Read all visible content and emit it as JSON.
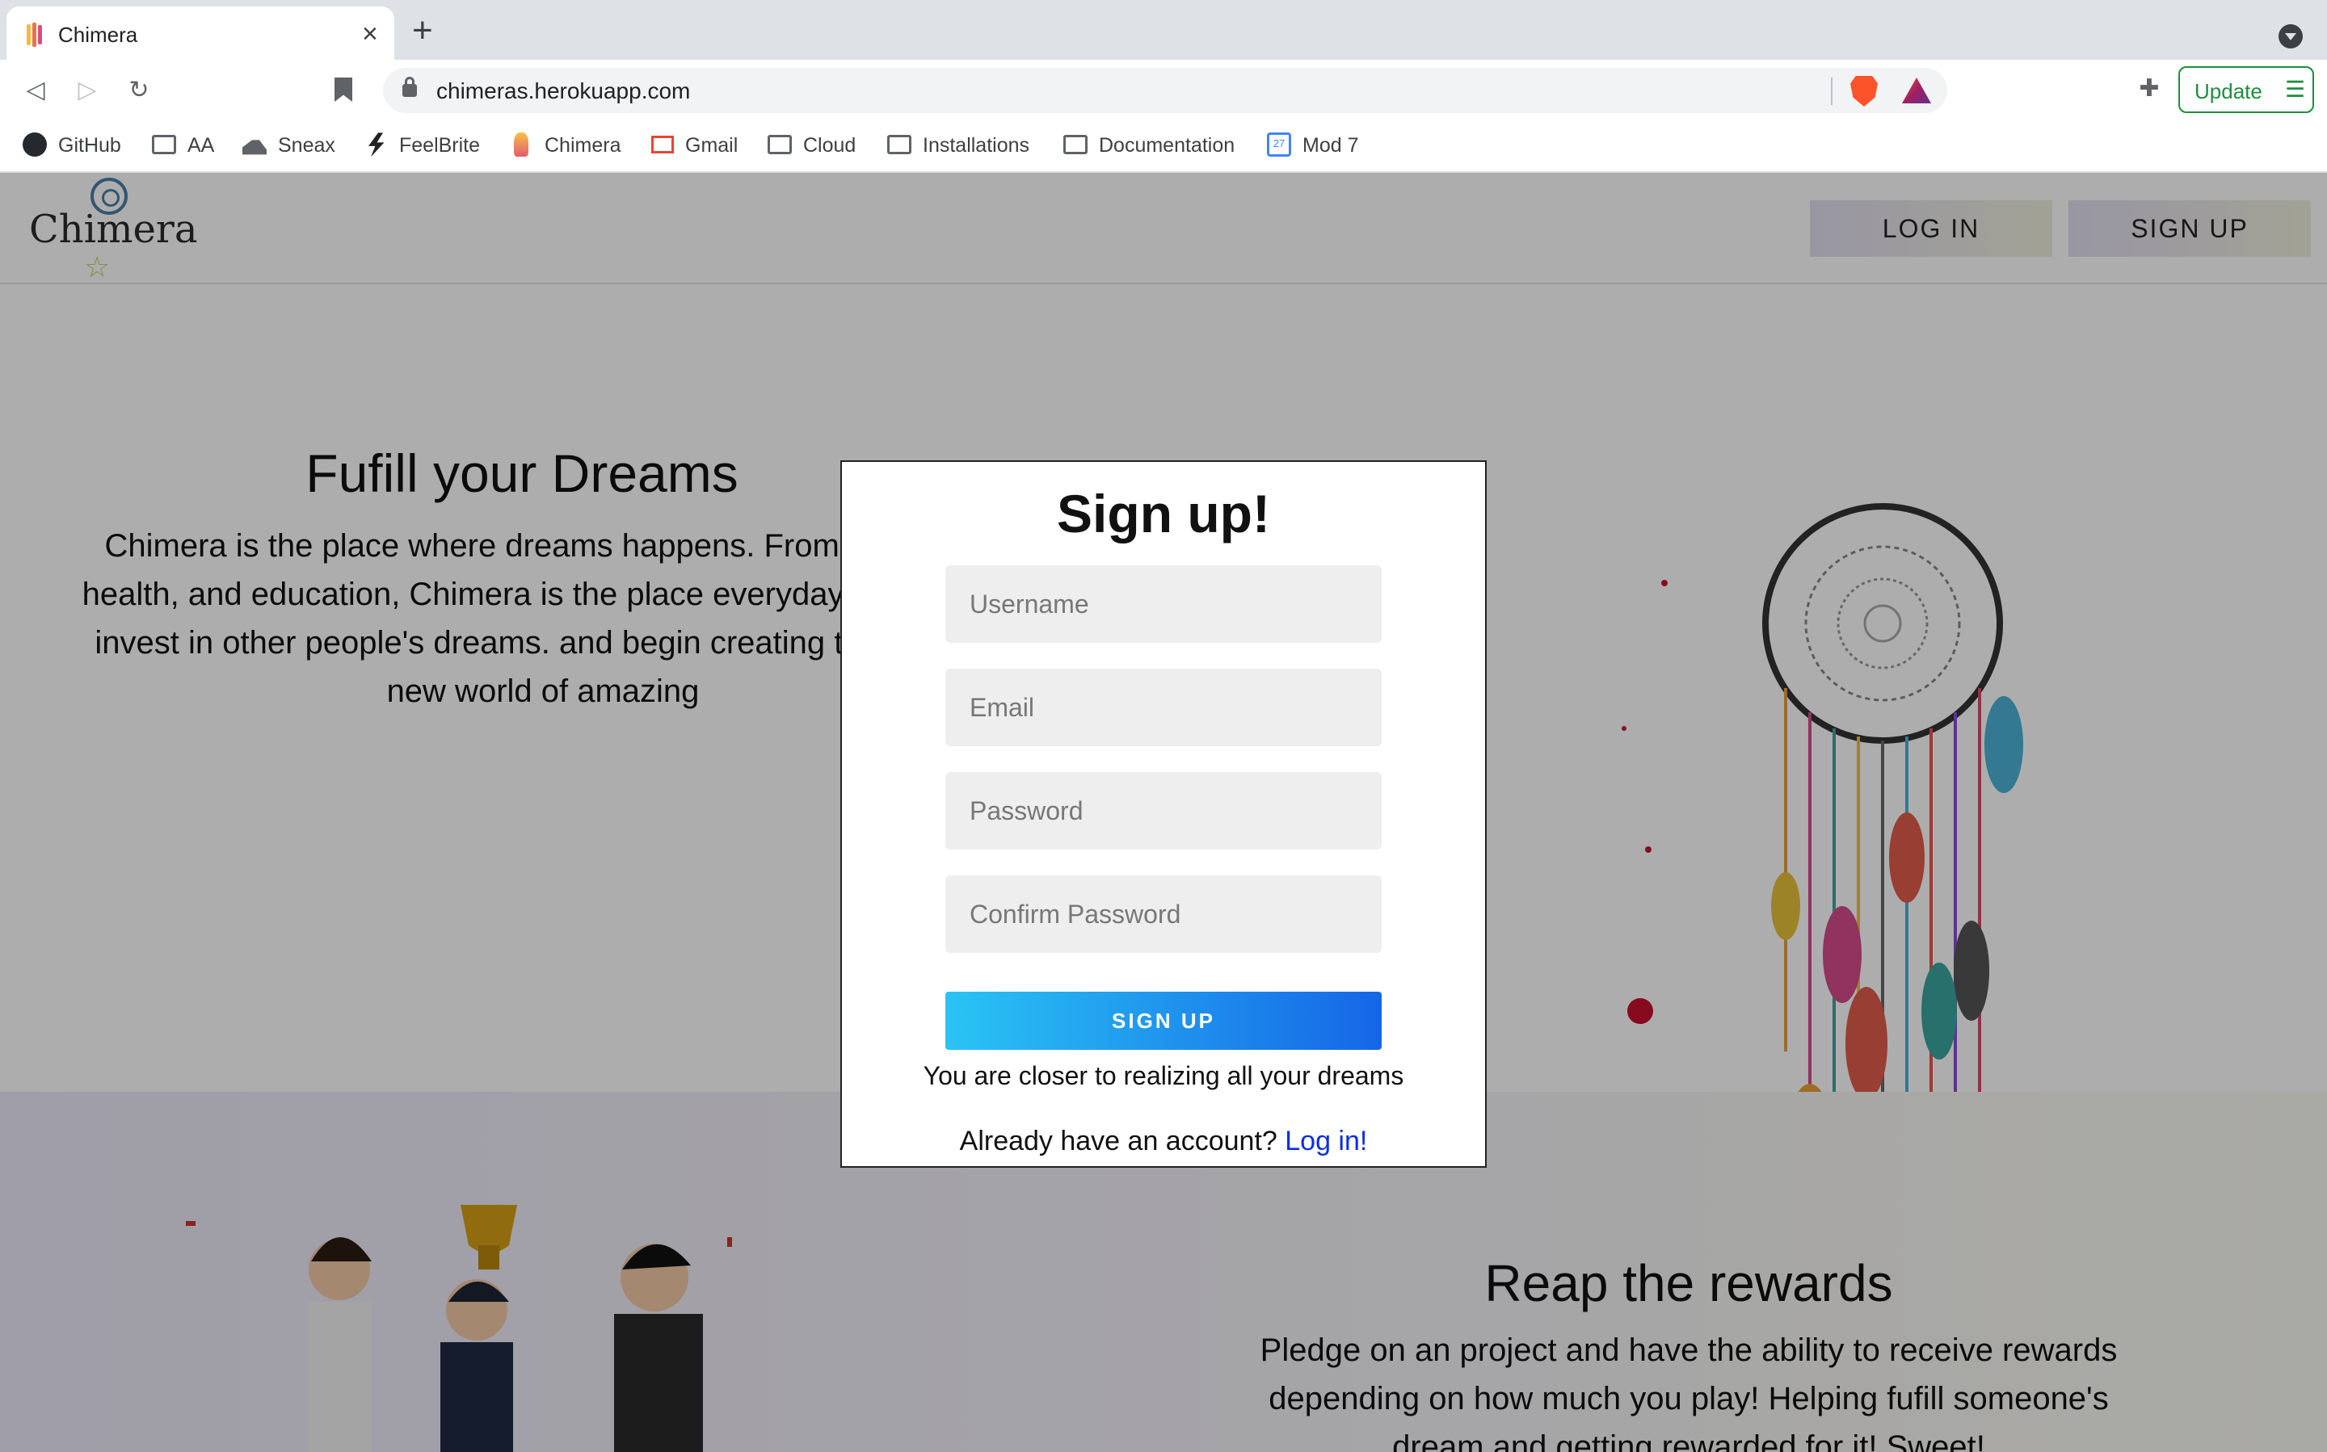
{
  "browser": {
    "tab_title": "Chimera",
    "url": "chimeras.herokuapp.com",
    "update_label": "Update",
    "bookmarks": [
      {
        "label": "GitHub",
        "icon": "github-icon"
      },
      {
        "label": "AA",
        "icon": "folder-icon"
      },
      {
        "label": "Sneax",
        "icon": "sneaker-icon"
      },
      {
        "label": "FeelBrite",
        "icon": "bolt-icon"
      },
      {
        "label": "Chimera",
        "icon": "chimera-icon"
      },
      {
        "label": "Gmail",
        "icon": "gmail-icon"
      },
      {
        "label": "Cloud",
        "icon": "folder-icon"
      },
      {
        "label": "Installations",
        "icon": "folder-icon"
      },
      {
        "label": "Documentation",
        "icon": "folder-icon"
      },
      {
        "label": "Mod 7",
        "icon": "calendar-icon"
      }
    ],
    "calendar_day": "27"
  },
  "site": {
    "logo": "Chimera",
    "login_label": "LOG IN",
    "signup_label": "SIGN UP",
    "hero_title": "Fufill your Dreams",
    "hero_text": "Chimera is the place where dreams happens. From g tech, to health, and education, Chimera is the place everyday individuals invest in other people's dreams. and begin creating tomorrow's new world of amazing",
    "rewards_title": "Reap the rewards",
    "rewards_text": "Pledge on an project and have the ability to receive rewards depending on how much you play! Helping fufill someone's dream and getting rewarded for it! Sweet!"
  },
  "modal": {
    "title": "Sign up!",
    "username_placeholder": "Username",
    "email_placeholder": "Email",
    "password_placeholder": "Password",
    "confirm_placeholder": "Confirm Password",
    "submit_label": "SIGN UP",
    "tagline": "You are closer to realizing all your dreams",
    "already_text": "Already have an account? ",
    "login_link": "Log in!"
  },
  "colors": {
    "accent_start": "#2ac4f4",
    "accent_end": "#1566e6",
    "link": "#0b2ee5",
    "update_green": "#1e8e3e"
  }
}
